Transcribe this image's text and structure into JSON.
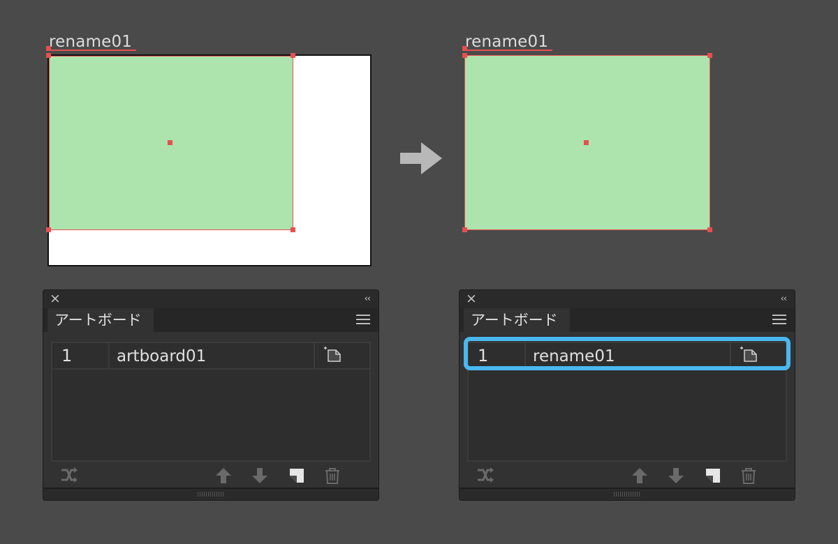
{
  "before": {
    "artboard_label": "rename01",
    "panel": {
      "tab_label": "アートボード",
      "rows": [
        {
          "number": "1",
          "name": "artboard01"
        }
      ]
    }
  },
  "after": {
    "artboard_label": "rename01",
    "panel": {
      "tab_label": "アートボード",
      "rows": [
        {
          "number": "1",
          "name": "rename01"
        }
      ]
    }
  },
  "icons": {
    "close": "×",
    "collapse": "‹‹",
    "transition_arrow": "arrow-right-icon"
  },
  "colors": {
    "background": "#4a4a4a",
    "shape_fill": "#ade3ac",
    "selection": "#e65050",
    "highlight": "#4ab8ef",
    "panel": "#323232"
  }
}
